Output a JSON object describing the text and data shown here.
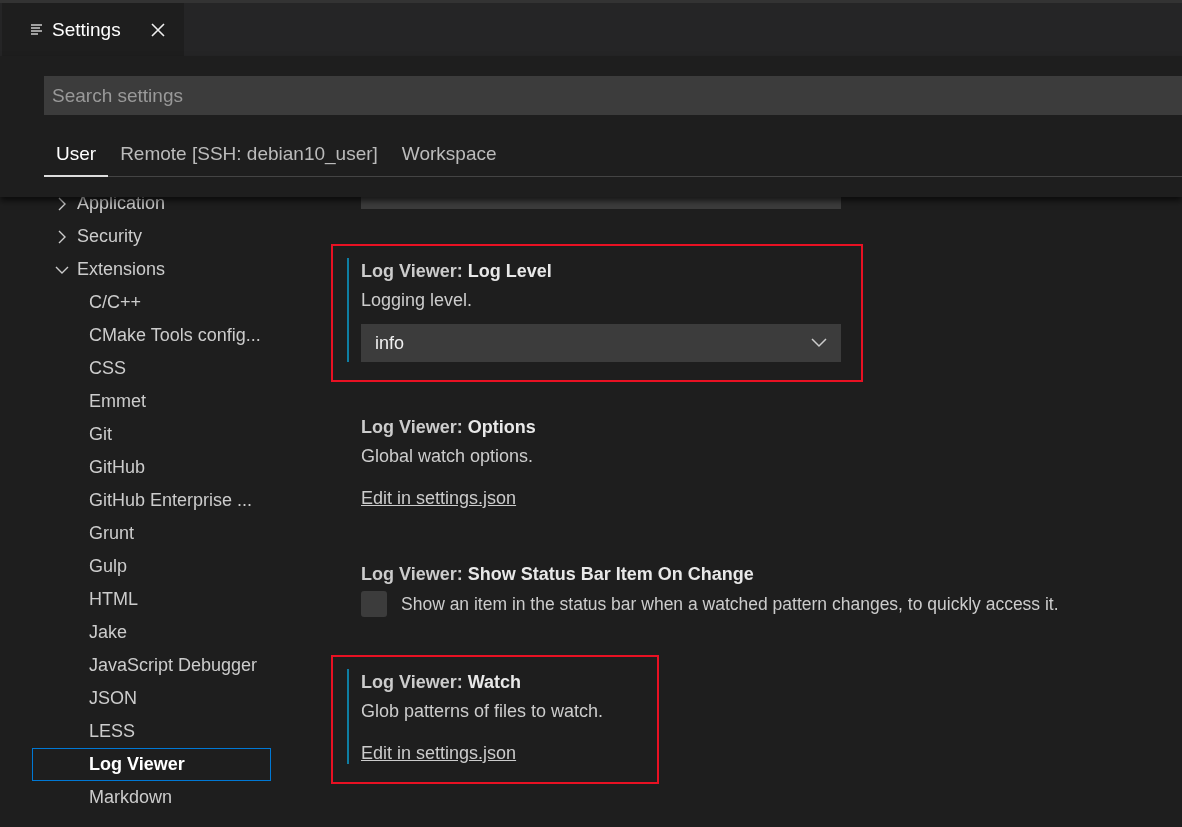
{
  "editor_tab": {
    "title": "Settings"
  },
  "search": {
    "placeholder": "Search settings"
  },
  "scope_tabs": [
    {
      "label": "User",
      "selected": true
    },
    {
      "label": "Remote [SSH: debian10_user]",
      "selected": false
    },
    {
      "label": "Workspace",
      "selected": false
    }
  ],
  "sidebar": {
    "items": [
      {
        "label": "Application",
        "expanded": false,
        "selected": false
      },
      {
        "label": "Security",
        "expanded": false,
        "selected": false
      },
      {
        "label": "Extensions",
        "expanded": true,
        "selected": false,
        "children": [
          {
            "label": "C/C++",
            "selected": false
          },
          {
            "label": "CMake Tools config...",
            "selected": false
          },
          {
            "label": "CSS",
            "selected": false
          },
          {
            "label": "Emmet",
            "selected": false
          },
          {
            "label": "Git",
            "selected": false
          },
          {
            "label": "GitHub",
            "selected": false
          },
          {
            "label": "GitHub Enterprise ...",
            "selected": false
          },
          {
            "label": "Grunt",
            "selected": false
          },
          {
            "label": "Gulp",
            "selected": false
          },
          {
            "label": "HTML",
            "selected": false
          },
          {
            "label": "Jake",
            "selected": false
          },
          {
            "label": "JavaScript Debugger",
            "selected": false
          },
          {
            "label": "JSON",
            "selected": false
          },
          {
            "label": "LESS",
            "selected": false
          },
          {
            "label": "Log Viewer",
            "selected": true
          },
          {
            "label": "Markdown",
            "selected": false
          }
        ]
      }
    ]
  },
  "settings": [
    {
      "kind": "select",
      "category": "Log Viewer: ",
      "name": "Log Level",
      "description": "Logging level.",
      "value": "info",
      "modified": true,
      "highlighted": true
    },
    {
      "kind": "json-link",
      "category": "Log Viewer: ",
      "name": "Options",
      "description": "Global watch options.",
      "link": "Edit in settings.json",
      "modified": false,
      "highlighted": false
    },
    {
      "kind": "checkbox",
      "category": "Log Viewer: ",
      "name": "Show Status Bar Item On Change",
      "description": "Show an item in the status bar when a watched pattern changes, to quickly access it.",
      "checked": false,
      "modified": false,
      "highlighted": false
    },
    {
      "kind": "json-link",
      "category": "Log Viewer: ",
      "name": "Watch",
      "description": "Glob patterns of files to watch.",
      "link": "Edit in settings.json",
      "modified": true,
      "highlighted": true
    }
  ]
}
